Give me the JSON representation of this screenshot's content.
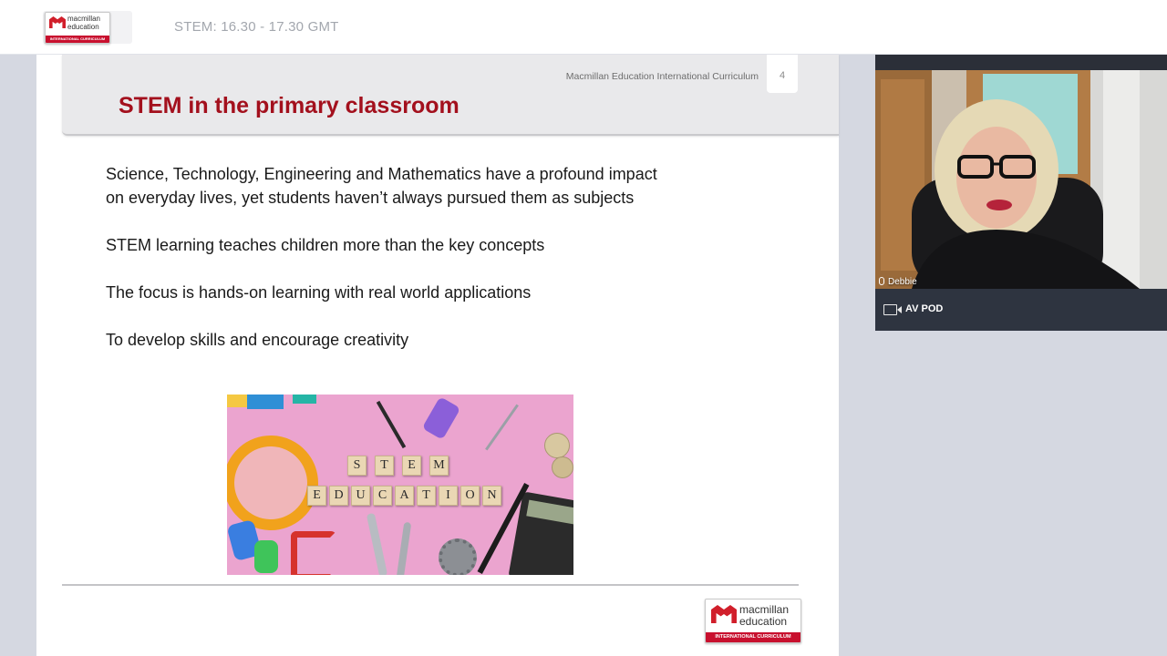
{
  "header": {
    "session_title": "STEM: 16.30 - 17.30 GMT",
    "logo": {
      "line1": "macmillan",
      "line2": "education",
      "band": "INTERNATIONAL CURRICULUM"
    }
  },
  "slide": {
    "brand_text": "Macmillan Education International Curriculum",
    "page_number": "4",
    "title": "STEM in the primary classroom",
    "bullets": [
      [
        "Science, Technology, Engineering and Mathematics have a profound impact",
        "on everyday lives, yet students haven’t  always pursued them as subjects"
      ],
      [
        "STEM learning teaches children more than the key concepts"
      ],
      [
        "The focus is hands-on learning with real world applications"
      ],
      [
        "To develop skills and encourage creativity"
      ]
    ],
    "image": {
      "tiles_row1": [
        "S",
        "T",
        "E",
        "M"
      ],
      "tiles_row2": [
        "E",
        "D",
        "U",
        "C",
        "A",
        "T",
        "I",
        "O",
        "N"
      ]
    },
    "footer_logo": {
      "line1": "macmillan",
      "line2": "education",
      "band": "INTERNATIONAL CURRICULUM"
    }
  },
  "video": {
    "speaker_name": "Debbie",
    "pod_label": "AV POD"
  },
  "colors": {
    "title_red": "#a3101d",
    "brand_red": "#c8102e",
    "page_bg": "#d5d8e1",
    "video_bar": "#2e3440"
  },
  "icons": {
    "mic": "mic-icon",
    "camera": "camera-icon"
  }
}
